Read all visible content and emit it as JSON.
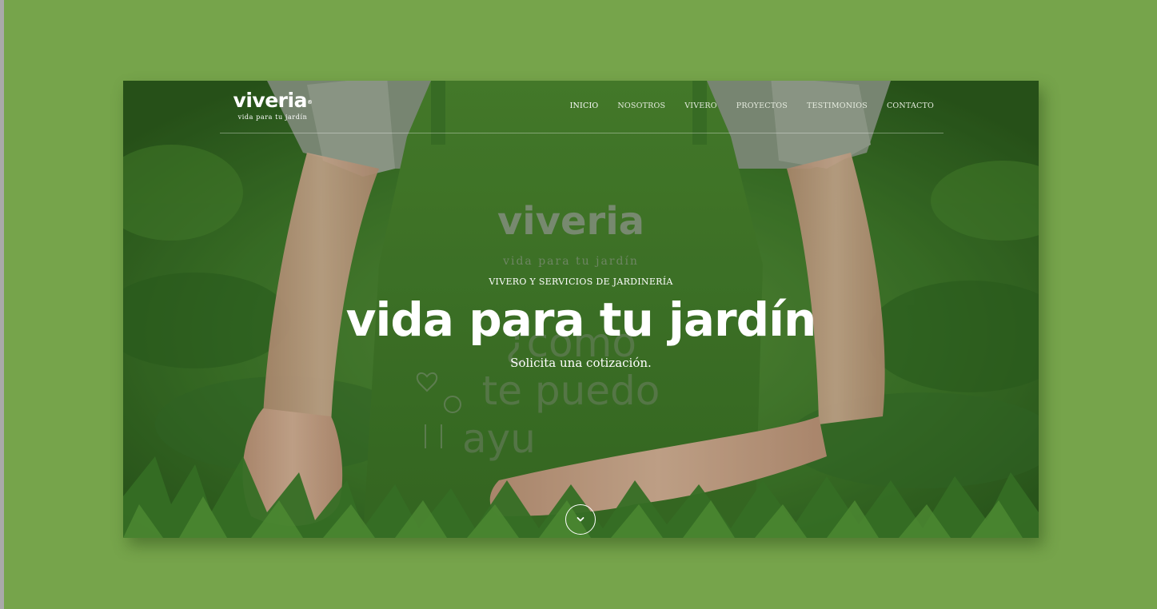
{
  "header": {
    "logo_word": "viveria",
    "logo_mark": "®",
    "logo_tagline": "vida para tu jardín"
  },
  "nav": {
    "items": [
      {
        "label": "INICIO",
        "active": true
      },
      {
        "label": "NOSOTROS",
        "active": false
      },
      {
        "label": "VIVERO",
        "active": false
      },
      {
        "label": "PROYECTOS",
        "active": false
      },
      {
        "label": "TESTIMONIOS",
        "active": false
      },
      {
        "label": "CONTACTO",
        "active": false
      }
    ]
  },
  "hero": {
    "eyebrow": "VIVERO Y SERVICIOS DE JARDINERÍA",
    "headline": "vida para tu jardín",
    "subline": "Solicita una cotización.",
    "scroll_icon": "chevron-down-icon"
  },
  "photo": {
    "apron_logo": "viveria",
    "apron_tagline": "vida para tu jardín",
    "apron_text_1": "¿cómo",
    "apron_text_2": "te puedo",
    "apron_text_3": "ayu"
  },
  "colors": {
    "page_background": "#76a44b",
    "apron": "#3f7a2a",
    "foliage": "#2f6a24",
    "text": "#ffffff"
  }
}
